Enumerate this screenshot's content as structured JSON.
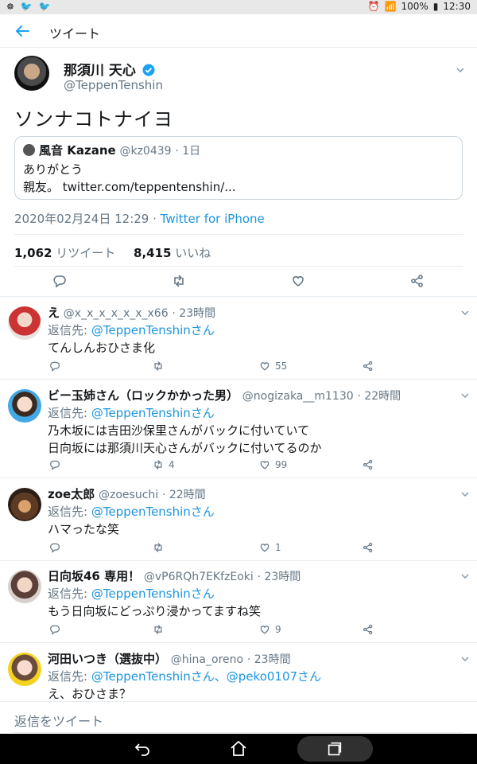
{
  "statusbar": {
    "battery": "100%",
    "time": "12:30"
  },
  "appbar": {
    "title": "ツイート"
  },
  "tweet": {
    "display_name": "那須川 天心",
    "handle": "@TeppenTenshin",
    "text": "ソンナコトナイヨ",
    "quote": {
      "name": "風音 Kazane",
      "handle": "@kz0439",
      "time": "· 1日",
      "line1": "ありがとう",
      "line2": "親友。 twitter.com/teppentenshin/..."
    },
    "date": "2020年02月24日 12:29",
    "source": "Twitter for iPhone",
    "retweets": "1,062",
    "retweets_label": "リツイート",
    "likes": "8,415",
    "likes_label": "いいね"
  },
  "replies": [
    {
      "name": "え",
      "handle": "@x_x_x_x_x_x_x66",
      "time": "· 23時間",
      "to_label": "返信先: ",
      "to": "@TeppenTenshinさん",
      "text": "てんしんおひさま化",
      "likes": "55",
      "retweets": ""
    },
    {
      "name": "ビー玉姉さん（ロックかかった男）",
      "handle": "@nogizaka__m1130",
      "time": "· 22時間",
      "to_label": "返信先: ",
      "to": "@TeppenTenshinさん",
      "text": "乃木坂には吉田沙保里さんがバックに付いていて\n日向坂には那須川天心さんがバックに付いてるのか",
      "likes": "99",
      "retweets": "4"
    },
    {
      "name": "zoe太郎",
      "handle": "@zoesuchi",
      "time": "· 22時間",
      "to_label": "返信先: ",
      "to": "@TeppenTenshinさん",
      "text": "ハマったな笑",
      "likes": "1",
      "retweets": ""
    },
    {
      "name": "日向坂46 専用！",
      "handle": "@vP6RQh7EKfzEoki",
      "time": "· 23時間",
      "to_label": "返信先: ",
      "to": "@TeppenTenshinさん",
      "text": "もう日向坂にどっぷり浸かってますね笑",
      "likes": "9",
      "retweets": ""
    },
    {
      "name": "河田いつき（選抜中）",
      "handle": "@hina_oreno",
      "time": "· 23時間",
      "to_label": "返信先: ",
      "to": "@TeppenTenshinさん、@peko0107さん",
      "text": "え、おひさま？",
      "likes": "",
      "retweets": ""
    }
  ],
  "compose": {
    "placeholder": "返信をツイート"
  },
  "colors": {
    "accent": "#1b95e0",
    "muted": "#657786",
    "divider": "#e6ecf0"
  }
}
